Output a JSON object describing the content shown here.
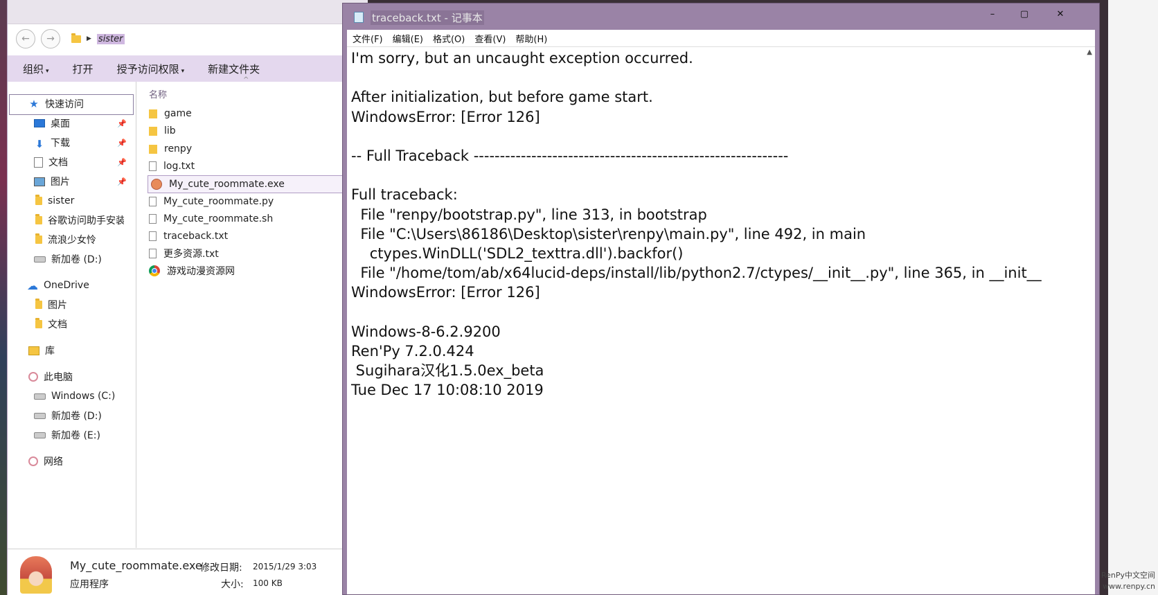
{
  "explorer": {
    "address": {
      "back": "←",
      "forward": "→",
      "folder": "sister"
    },
    "ribbon": [
      {
        "label": "组织",
        "caret": "▾"
      },
      {
        "label": "打开",
        "caret": ""
      },
      {
        "label": "授予访问权限",
        "caret": "▾"
      },
      {
        "label": "新建文件夹",
        "caret": ""
      }
    ],
    "nav": {
      "quick_access": "快速访问",
      "items": [
        "桌面",
        "下载",
        "文档",
        "图片",
        "sister",
        "谷歌访问助手安装",
        "流浪少女怜",
        "新加卷 (D:)"
      ],
      "onedrive": "OneDrive",
      "onedrive_items": [
        "图片",
        "文档"
      ],
      "library": "库",
      "this_pc": "此电脑",
      "drives": [
        "Windows (C:)",
        "新加卷 (D:)",
        "新加卷 (E:)"
      ],
      "network": "网络",
      "pin": "📌"
    },
    "column_header": "名称",
    "sort_caret": "^",
    "files": [
      {
        "name": "game",
        "type": "folder"
      },
      {
        "name": "lib",
        "type": "folder"
      },
      {
        "name": "renpy",
        "type": "folder"
      },
      {
        "name": "log.txt",
        "type": "txt"
      },
      {
        "name": "My_cute_roommate.exe",
        "type": "exe"
      },
      {
        "name": "My_cute_roommate.py",
        "type": "txt"
      },
      {
        "name": "My_cute_roommate.sh",
        "type": "txt"
      },
      {
        "name": "traceback.txt",
        "type": "txt"
      },
      {
        "name": "更多资源.txt",
        "type": "txt"
      },
      {
        "name": "游戏动漫资源网",
        "type": "chrome"
      }
    ],
    "details": {
      "name": "My_cute_roommate.exe",
      "type": "应用程序",
      "modified_label": "修改日期:",
      "modified_value": "2015/1/29 3:03",
      "size_label": "大小:",
      "size_value": "100 KB"
    }
  },
  "notepad": {
    "title": "traceback.txt - 记事本",
    "controls": {
      "minimize": "▭",
      "maximize": "▢",
      "close": "✕"
    },
    "menu": [
      "文件(F)",
      "编辑(E)",
      "格式(O)",
      "查看(V)",
      "帮助(H)"
    ],
    "lines": [
      "I'm sorry, but an uncaught exception occurred.",
      "",
      "After initialization, but before game start.",
      "WindowsError: [Error 126]",
      "",
      "-- Full Traceback ------------------------------------------------------------",
      "",
      "Full traceback:",
      "  File \"renpy/bootstrap.py\", line 313, in bootstrap",
      "  File \"C:\\Users\\86186\\Desktop\\sister\\renpy\\main.py\", line 492, in main",
      "    ctypes.WinDLL('SDL2_texttra.dll').backfor()",
      "  File \"/home/tom/ab/x64lucid-deps/install/lib/python2.7/ctypes/__init__.py\", line 365, in __init__",
      "WindowsError: [Error 126]",
      "",
      "Windows-8-6.2.9200",
      "Ren'Py 7.2.0.424",
      " Sugihara汉化1.5.0ex_beta",
      "Tue Dec 17 10:08:10 2019"
    ]
  },
  "watermark": {
    "line1": "RenPy中文空间",
    "line2": "www.renpy.cn"
  }
}
